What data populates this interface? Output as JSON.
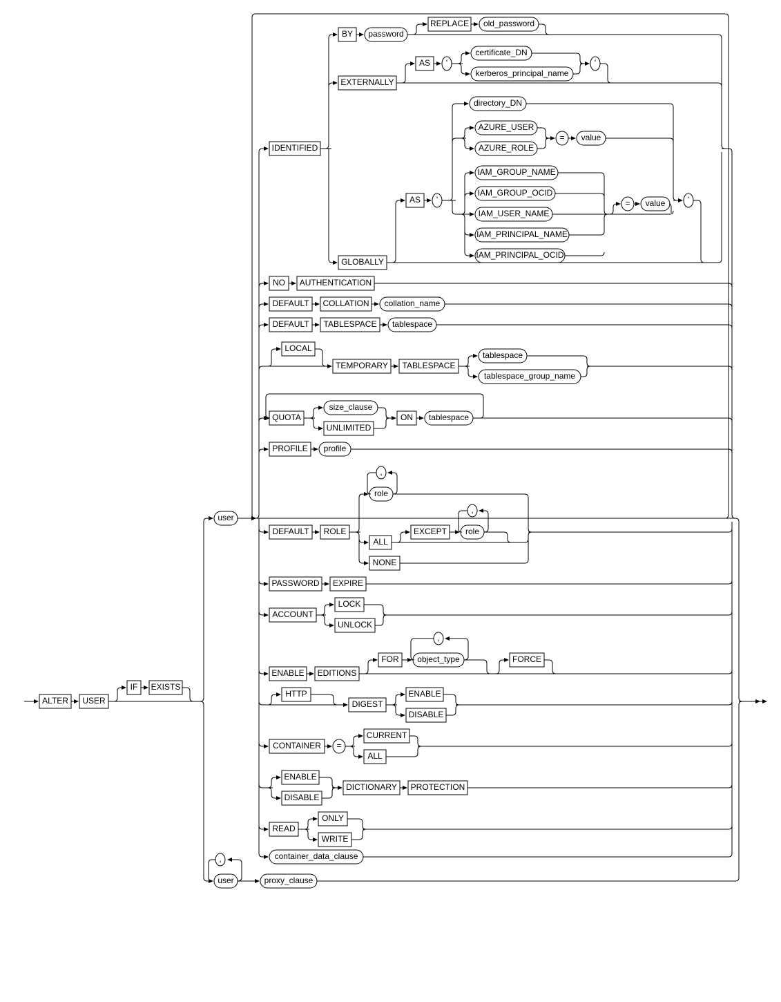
{
  "diagram_type": "railroad_syntax_diagram",
  "statement": "ALTER USER",
  "tokens": {
    "alter": "ALTER",
    "user_kw": "USER",
    "if": "IF",
    "exists": "EXISTS",
    "user": "user",
    "identified": "IDENTIFIED",
    "by": "BY",
    "password": "password",
    "replace": "REPLACE",
    "old_password": "old_password",
    "externally": "EXTERNALLY",
    "as": "AS",
    "quote": "'",
    "certificate_dn": "certificate_DN",
    "kerberos_principal_name": "kerberos_principal_name",
    "globally": "GLOBALLY",
    "directory_dn": "directory_DN",
    "azure_user": "AZURE_USER",
    "azure_role": "AZURE_ROLE",
    "equals": "=",
    "value": "value",
    "iam_group_name": "IAM_GROUP_NAME",
    "iam_group_ocid": "IAM_GROUP_OCID",
    "iam_user_name": "IAM_USER_NAME",
    "iam_principal_name": "IAM_PRINCIPAL_NAME",
    "iam_principal_ocid": "IAM_PRINCIPAL_OCID",
    "no": "NO",
    "authentication": "AUTHENTICATION",
    "default": "DEFAULT",
    "collation": "COLLATION",
    "collation_name": "collation_name",
    "tablespace_kw": "TABLESPACE",
    "tablespace": "tablespace",
    "local": "LOCAL",
    "temporary": "TEMPORARY",
    "tablespace_group_name": "tablespace_group_name",
    "quota": "QUOTA",
    "size_clause": "size_clause",
    "unlimited": "UNLIMITED",
    "on": "ON",
    "profile_kw": "PROFILE",
    "profile": "profile",
    "role_kw": "ROLE",
    "role": "role",
    "comma": ",",
    "all": "ALL",
    "except": "EXCEPT",
    "none": "NONE",
    "password_kw": "PASSWORD",
    "expire": "EXPIRE",
    "account": "ACCOUNT",
    "lock": "LOCK",
    "unlock": "UNLOCK",
    "enable": "ENABLE",
    "editions": "EDITIONS",
    "for": "FOR",
    "object_type": "object_type",
    "force": "FORCE",
    "http": "HTTP",
    "digest": "DIGEST",
    "disable": "DISABLE",
    "container": "CONTAINER",
    "current": "CURRENT",
    "dictionary": "DICTIONARY",
    "protection": "PROTECTION",
    "read": "READ",
    "only": "ONLY",
    "write": "WRITE",
    "container_data_clause": "container_data_clause",
    "proxy_clause": "proxy_clause"
  }
}
